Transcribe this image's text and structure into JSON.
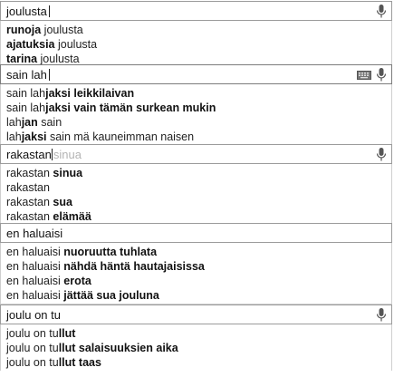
{
  "panels": [
    {
      "query": "joulusta",
      "ghost": "",
      "show_caret": true,
      "show_keyboard": false,
      "suggestions": [
        {
          "normal_before": "",
          "bold": "runoja",
          "normal_after": " joulusta"
        },
        {
          "normal_before": "",
          "bold": "ajatuksia",
          "normal_after": " joulusta"
        },
        {
          "normal_before": "",
          "bold": "tarina",
          "normal_after": " joulusta"
        }
      ]
    },
    {
      "query": "sain lah",
      "ghost": "",
      "show_caret": true,
      "show_keyboard": true,
      "suggestions": [
        {
          "normal_before": "sain lah",
          "bold": "jaksi leikkilaivan",
          "normal_after": ""
        },
        {
          "normal_before": "sain lah",
          "bold": "jaksi vain tämän surkean mukin",
          "normal_after": ""
        },
        {
          "normal_before": "lah",
          "bold": "jan",
          "normal_after": " sain"
        },
        {
          "normal_before": "lah",
          "bold": "jaksi",
          "normal_after": " sain mä kauneimman naisen"
        }
      ]
    },
    {
      "query": "rakastan",
      "ghost": "sinua",
      "show_caret": true,
      "show_keyboard": false,
      "suggestions": [
        {
          "normal_before": "rakastan ",
          "bold": "sinua",
          "normal_after": ""
        },
        {
          "normal_before": "rakastan",
          "bold": "",
          "normal_after": ""
        },
        {
          "normal_before": "rakastan ",
          "bold": "sua",
          "normal_after": ""
        },
        {
          "normal_before": "rakastan ",
          "bold": "elämää",
          "normal_after": ""
        }
      ]
    },
    {
      "query": "en haluaisi",
      "ghost": "",
      "show_caret": false,
      "show_keyboard": false,
      "show_mic": false,
      "suggestions": [
        {
          "normal_before": "en haluaisi ",
          "bold": "nuoruutta tuhlata",
          "normal_after": ""
        },
        {
          "normal_before": "en haluaisi ",
          "bold": "nähdä häntä hautajaisissa",
          "normal_after": ""
        },
        {
          "normal_before": "en haluaisi ",
          "bold": "erota",
          "normal_after": ""
        },
        {
          "normal_before": "en haluaisi ",
          "bold": "jättää sua jouluna",
          "normal_after": ""
        }
      ]
    },
    {
      "query": "joulu on tu",
      "ghost": "",
      "show_caret": false,
      "show_keyboard": false,
      "suggestions": [
        {
          "normal_before": "joulu on tu",
          "bold": "llut",
          "normal_after": ""
        },
        {
          "normal_before": "joulu on tu",
          "bold": "llut salaisuuksien aika",
          "normal_after": ""
        },
        {
          "normal_before": "joulu on tu",
          "bold": "llut taas",
          "normal_after": ""
        }
      ]
    }
  ],
  "icons": {
    "mic": "microphone-icon",
    "keyboard": "keyboard-icon"
  }
}
